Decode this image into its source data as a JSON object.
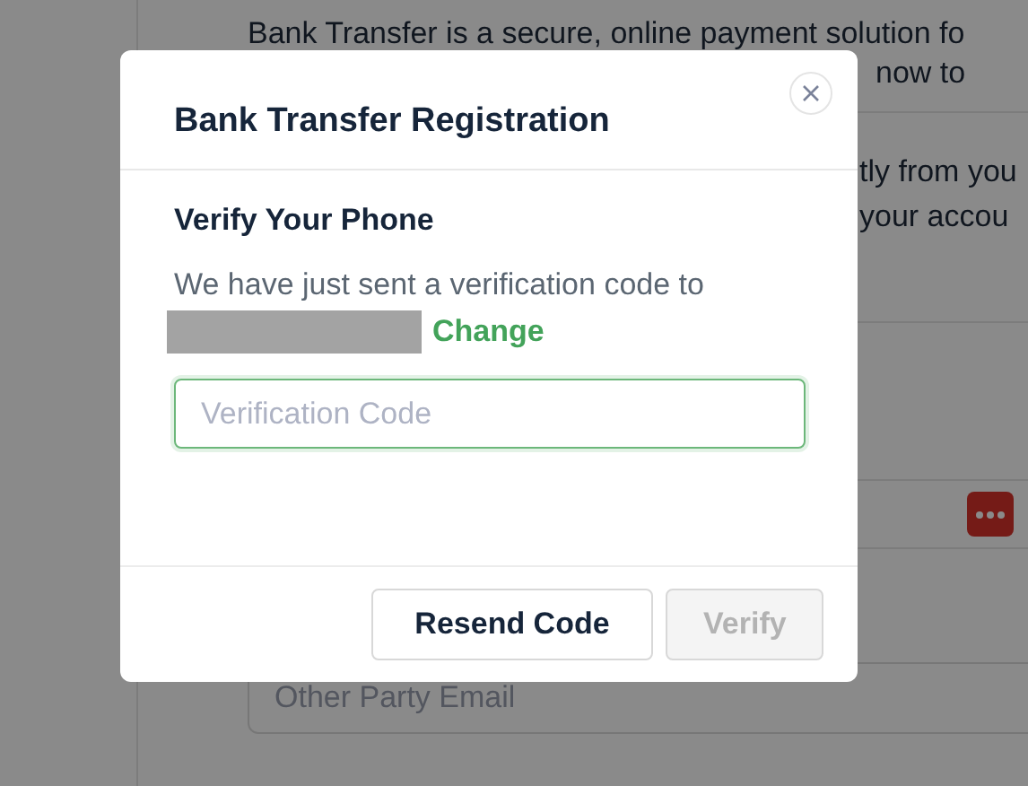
{
  "background": {
    "intro_lines": [
      "Bank Transfer is a secure, online payment solution fo",
      "now to"
    ],
    "side_lines": [
      "tly from you",
      "your accou"
    ],
    "email_field": {
      "placeholder": "Other Party Email"
    }
  },
  "modal": {
    "title": "Bank Transfer Registration",
    "heading": "Verify Your Phone",
    "message": "We have just sent a verification code to",
    "change_link": "Change",
    "code_field": {
      "placeholder": "Verification Code",
      "focused": true
    },
    "buttons": [
      {
        "label": "Resend Code",
        "disabled": false
      },
      {
        "label": "Verify",
        "disabled": true
      }
    ]
  }
}
